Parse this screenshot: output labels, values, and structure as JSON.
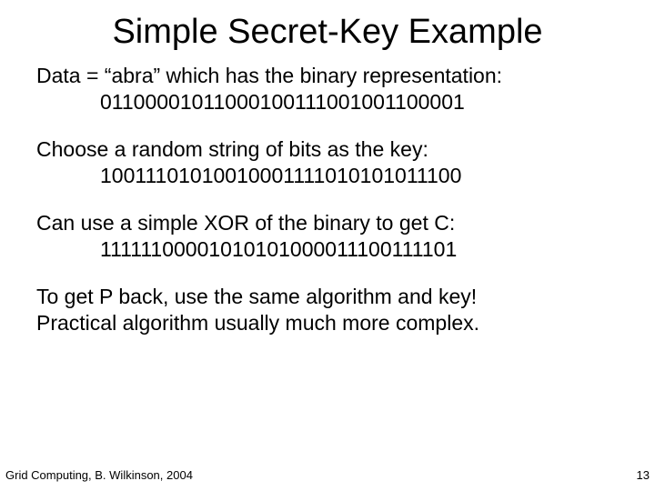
{
  "title": "Simple Secret-Key Example",
  "data_line": "Data = “abra” which has the binary representation:",
  "data_bits": "01100001011000100111001001100001",
  "key_line": "Choose a random string of bits as the key:",
  "key_bits": "10011101010010001111010101011100",
  "xor_line": "Can use a simple XOR of the binary to get C:",
  "xor_bits": "11111100001010101000011100111101",
  "closing_1": "To get P back, use the same algorithm and key!",
  "closing_2": "Practical algorithm usually much more complex.",
  "footer_source": "Grid Computing, B. Wilkinson, 2004",
  "footer_page": "13"
}
